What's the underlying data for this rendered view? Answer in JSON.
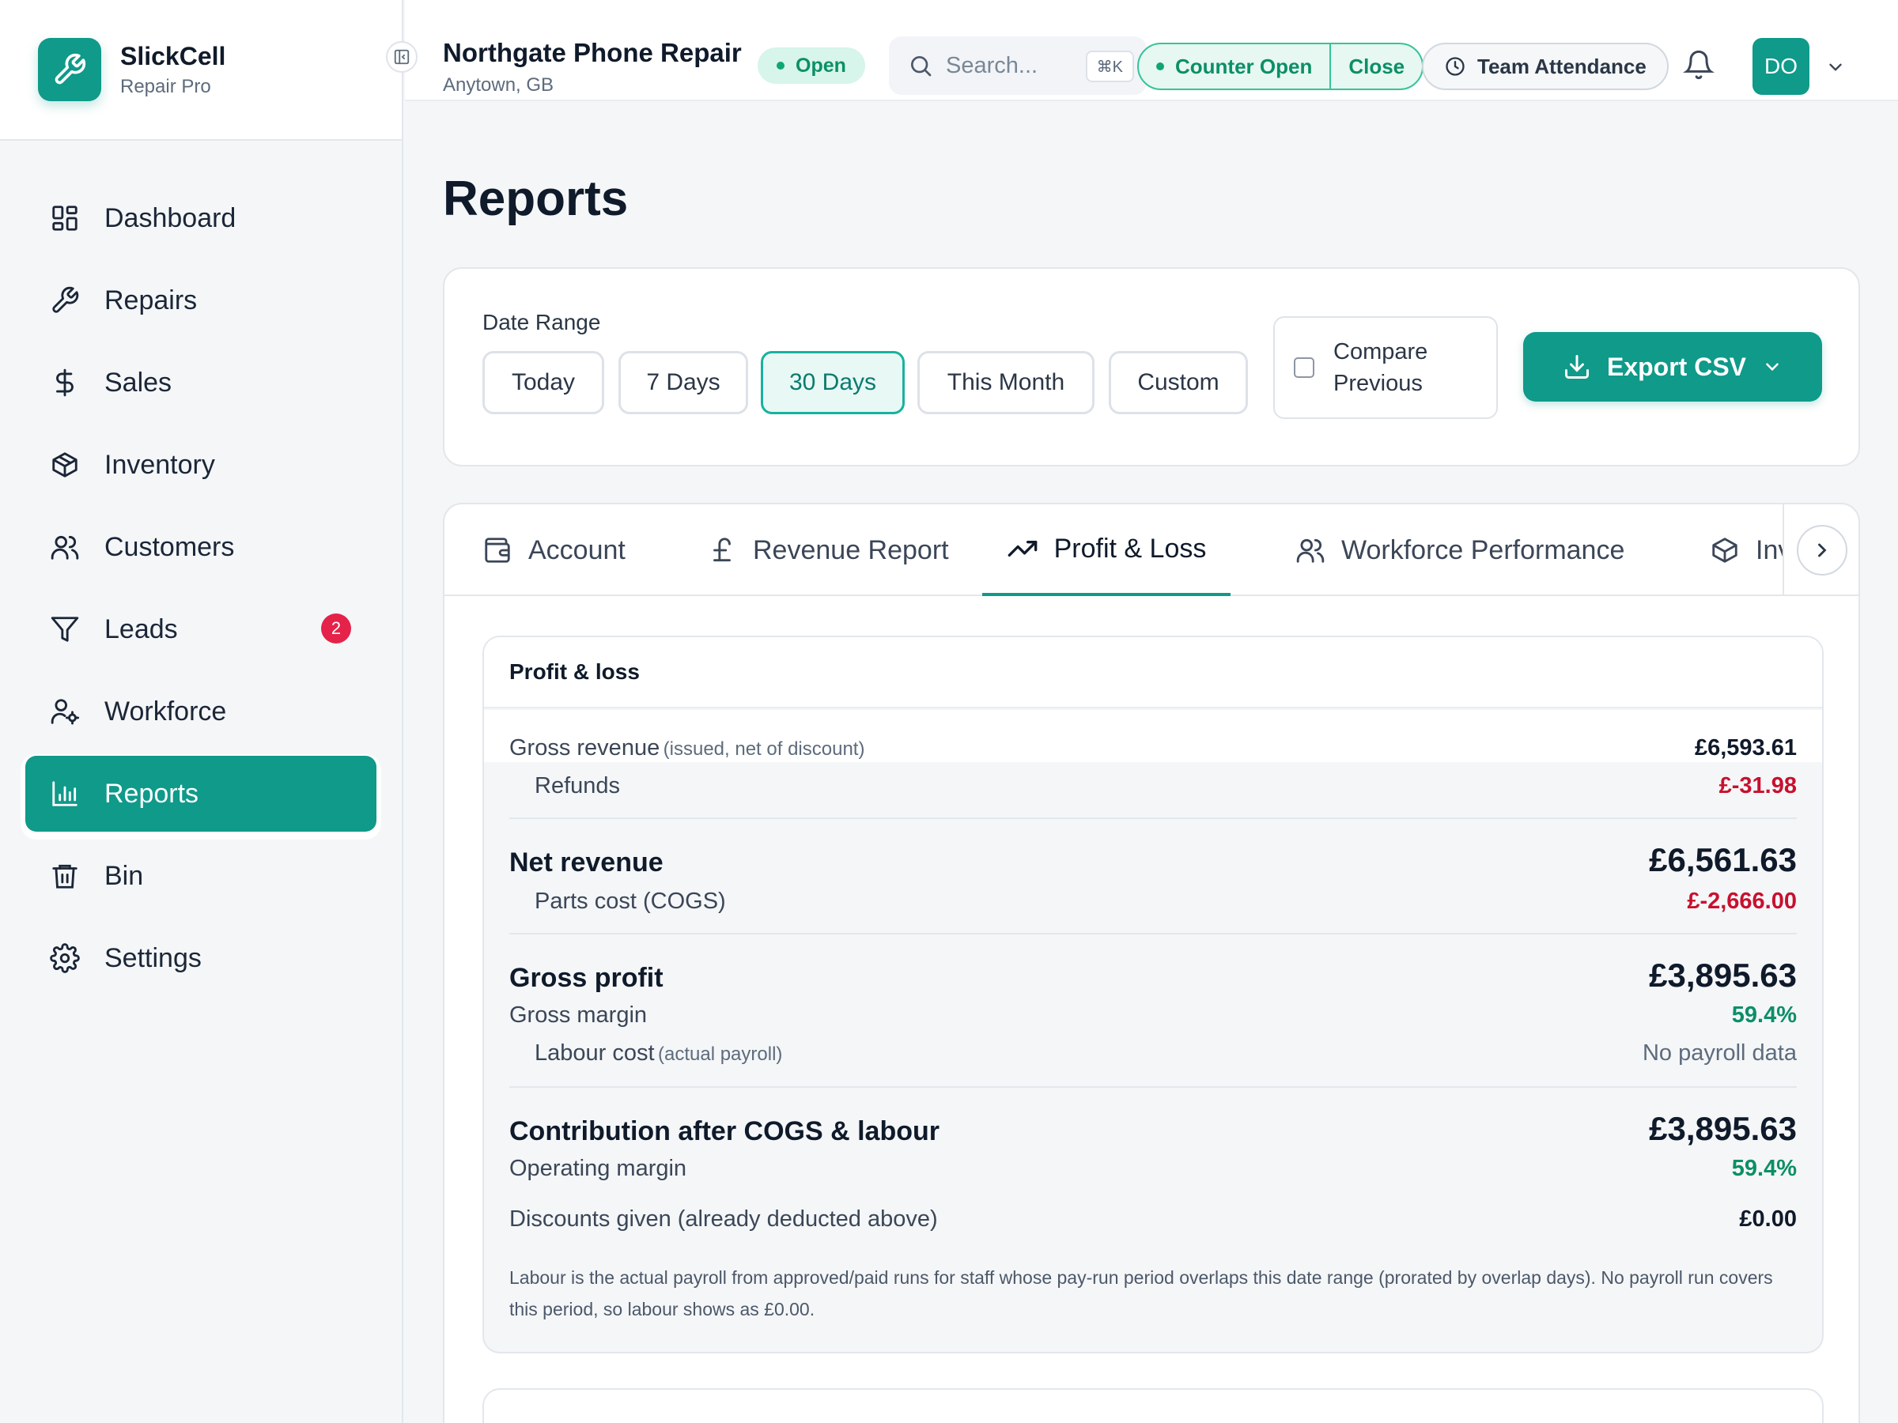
{
  "brand": {
    "name": "SlickCell",
    "subtitle": "Repair Pro"
  },
  "sidebar": {
    "items": [
      {
        "label": "Dashboard",
        "icon": "dashboard-icon"
      },
      {
        "label": "Repairs",
        "icon": "wrench-icon"
      },
      {
        "label": "Sales",
        "icon": "dollar-icon"
      },
      {
        "label": "Inventory",
        "icon": "box-icon"
      },
      {
        "label": "Customers",
        "icon": "users-icon"
      },
      {
        "label": "Leads",
        "icon": "filter-icon",
        "badge": "2"
      },
      {
        "label": "Workforce",
        "icon": "user-gear-icon"
      },
      {
        "label": "Reports",
        "icon": "bar-chart-icon",
        "active": true
      },
      {
        "label": "Bin",
        "icon": "trash-icon"
      },
      {
        "label": "Settings",
        "icon": "gear-icon"
      }
    ]
  },
  "header": {
    "shop_name": "Northgate Phone Repair",
    "shop_location": "Anytown, GB",
    "status": "Open",
    "search_placeholder": "Search...",
    "search_shortcut": "⌘K",
    "counter_status": "Counter Open",
    "counter_close": "Close",
    "attendance": "Team Attendance",
    "avatar_initials": "DO"
  },
  "page": {
    "title": "Reports"
  },
  "filters": {
    "date_range_label": "Date Range",
    "ranges": [
      "Today",
      "7 Days",
      "30 Days",
      "This Month",
      "Custom"
    ],
    "active_range": "30 Days",
    "compare_label_1": "Compare",
    "compare_label_2": "Previous",
    "compare_checked": false,
    "export_label": "Export CSV"
  },
  "tabs": [
    {
      "label": "Account",
      "icon": "wallet-icon"
    },
    {
      "label": "Revenue Report",
      "icon": "pound-icon"
    },
    {
      "label": "Profit & Loss",
      "icon": "trending-up-icon",
      "active": true
    },
    {
      "label": "Workforce Performance",
      "icon": "users-icon"
    },
    {
      "label": "Inv",
      "icon": "box-icon"
    }
  ],
  "profit_loss": {
    "title": "Profit & loss",
    "gross_revenue": {
      "label": "Gross revenue",
      "note": "(issued, net of discount)",
      "value": "£6,593.61"
    },
    "refunds": {
      "label": "Refunds",
      "value": "£-31.98"
    },
    "net_revenue": {
      "label": "Net revenue",
      "value": "£6,561.63"
    },
    "parts_cost": {
      "label": "Parts cost (COGS)",
      "value": "£-2,666.00"
    },
    "gross_profit": {
      "label": "Gross profit",
      "value": "£3,895.63"
    },
    "gross_margin": {
      "label": "Gross margin",
      "value": "59.4%"
    },
    "labour_cost": {
      "label": "Labour cost",
      "note": "(actual payroll)",
      "value": "No payroll data"
    },
    "contribution": {
      "label": "Contribution after COGS & labour",
      "value": "£3,895.63"
    },
    "operating_margin": {
      "label": "Operating margin",
      "value": "59.4%"
    },
    "discounts": {
      "label": "Discounts given (already deducted above)",
      "value": "£0.00"
    },
    "footnote": "Labour is the actual payroll from approved/paid runs for staff whose pay-run period overlaps this date range (prorated by overlap days). No payroll run covers this period, so labour shows as £0.00."
  },
  "colors": {
    "accent": "#0f9a8a",
    "negative": "#c8102e",
    "positive": "#0c8f66",
    "badge": "#e5224a"
  }
}
